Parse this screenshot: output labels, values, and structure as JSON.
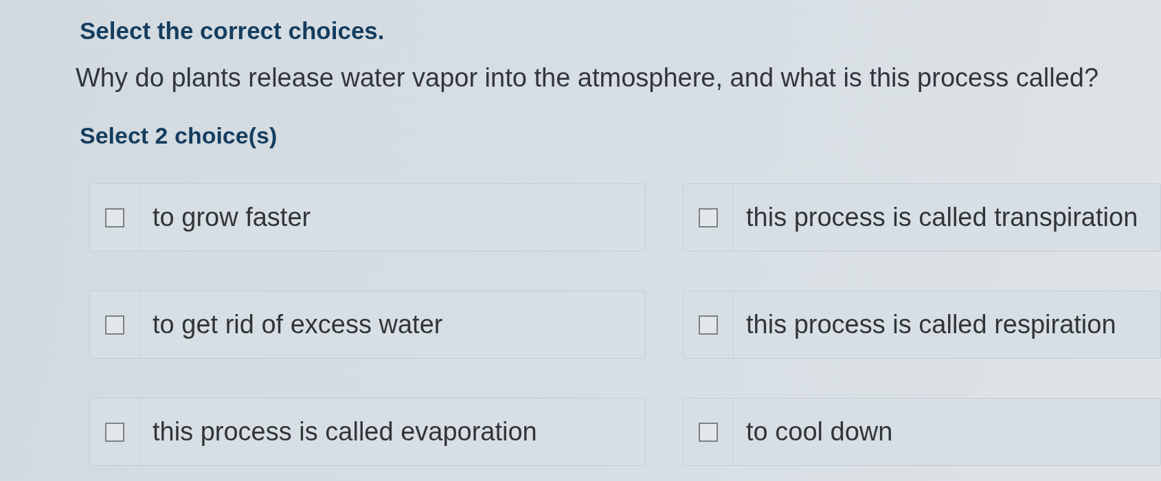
{
  "instruction": "Select the correct choices.",
  "question": "Why do plants release water vapor into the atmosphere, and what is this process called?",
  "select_hint": "Select 2 choice(s)",
  "choices": [
    {
      "label": "to grow faster",
      "checked": false
    },
    {
      "label": "this process is called transpiration",
      "checked": false
    },
    {
      "label": "to get rid of excess water",
      "checked": false
    },
    {
      "label": "this process is called respiration",
      "checked": false
    },
    {
      "label": "this process is called evaporation",
      "checked": false
    },
    {
      "label": "to cool down",
      "checked": false
    }
  ]
}
